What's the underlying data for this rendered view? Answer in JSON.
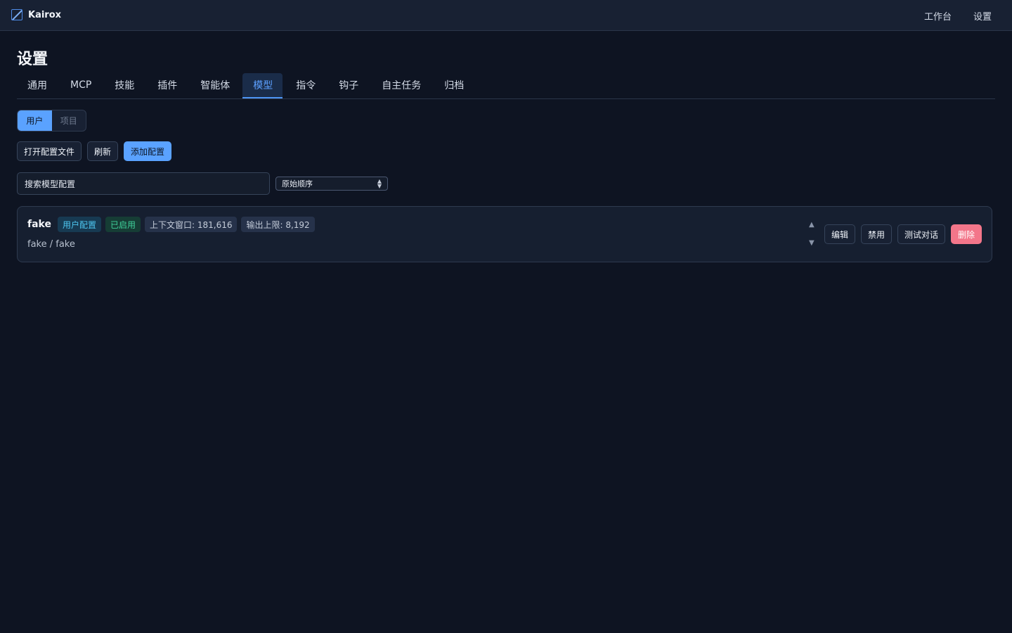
{
  "app": {
    "name": "Kairox"
  },
  "topnav": {
    "workbench": "工作台",
    "settings": "设置"
  },
  "page": {
    "title": "设置"
  },
  "tabs": [
    {
      "label": "通用"
    },
    {
      "label": "MCP"
    },
    {
      "label": "技能"
    },
    {
      "label": "插件"
    },
    {
      "label": "智能体"
    },
    {
      "label": "模型",
      "active": true
    },
    {
      "label": "指令"
    },
    {
      "label": "钩子"
    },
    {
      "label": "自主任务"
    },
    {
      "label": "归档"
    }
  ],
  "scope": {
    "user": "用户",
    "project": "项目",
    "selected": "用户"
  },
  "actions": {
    "open_config": "打开配置文件",
    "refresh": "刷新",
    "add_config": "添加配置"
  },
  "search": {
    "placeholder": "搜索模型配置"
  },
  "sort": {
    "selected": "原始顺序"
  },
  "model_card": {
    "name": "fake",
    "tag_source": "用户配置",
    "tag_status": "已启用",
    "context_window": "上下文窗口: 181,616",
    "output_limit": "输出上限: 8,192",
    "subtitle": "fake / fake",
    "move_up": "▲",
    "move_down": "▼",
    "edit": "编辑",
    "disable": "禁用",
    "test_chat": "测试对话",
    "delete": "删除"
  },
  "colors": {
    "accent": "#5aa2ff",
    "danger": "#f3768a",
    "success": "#3fd09a",
    "info": "#4dc7f0"
  }
}
